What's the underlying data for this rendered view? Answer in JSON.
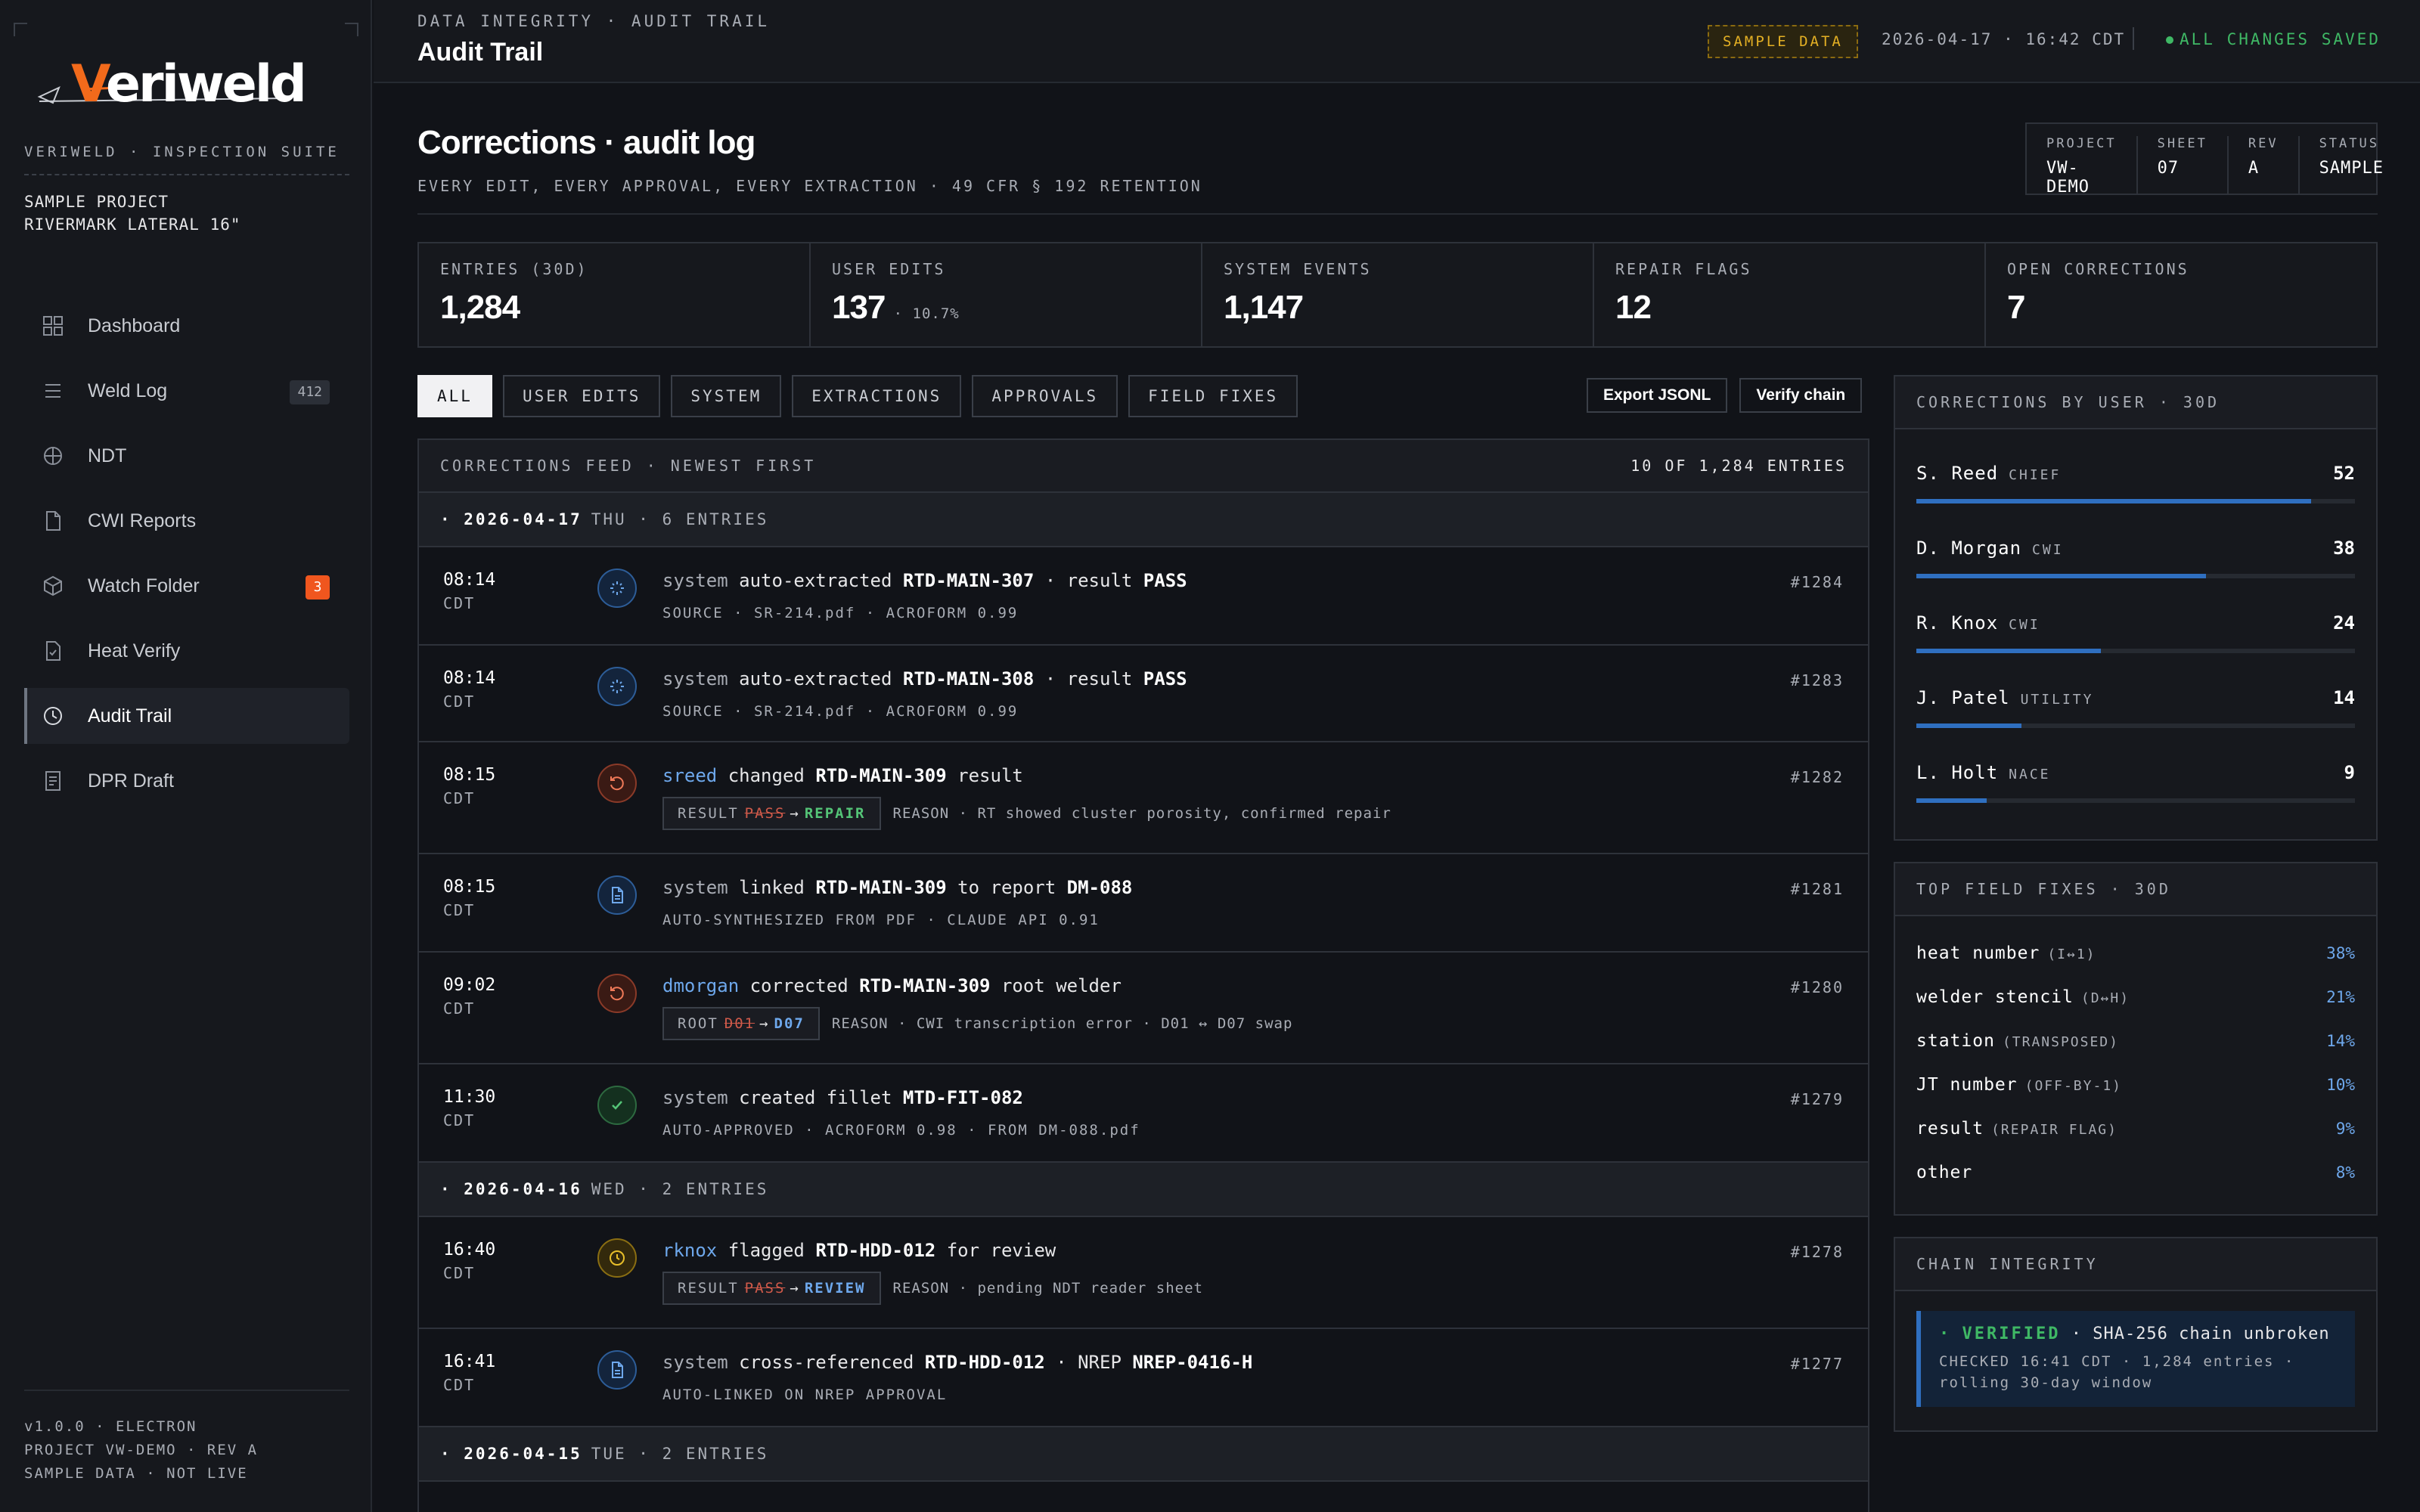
{
  "app": {
    "brand": "Veriweld",
    "brand_first": "V",
    "brand_rest": "eriweld",
    "suite": "VERIWELD · INSPECTION SUITE",
    "project_line1": "SAMPLE PROJECT",
    "project_line2": "RIVERMARK LATERAL 16\"",
    "footer_line1": "v1.0.0 · ELECTRON",
    "footer_line2": "PROJECT VW-DEMO · REV A",
    "footer_line3": "SAMPLE DATA · NOT LIVE"
  },
  "nav": [
    {
      "label": "Dashboard",
      "icon": "grid-icon",
      "badge": ""
    },
    {
      "label": "Weld Log",
      "icon": "list-icon",
      "badge": "412"
    },
    {
      "label": "NDT",
      "icon": "crosshair-icon",
      "badge": ""
    },
    {
      "label": "CWI Reports",
      "icon": "document-icon",
      "badge": ""
    },
    {
      "label": "Watch Folder",
      "icon": "cube-icon",
      "badge": "3"
    },
    {
      "label": "Heat Verify",
      "icon": "file-check-icon",
      "badge": ""
    },
    {
      "label": "Audit Trail",
      "icon": "clock-icon",
      "badge": "",
      "active": true
    },
    {
      "label": "DPR Draft",
      "icon": "report-icon",
      "badge": ""
    }
  ],
  "topbar": {
    "breadcrumb": "DATA INTEGRITY · AUDIT TRAIL",
    "title": "Audit Trail",
    "sample_badge": "SAMPLE DATA",
    "datetime": "2026-04-17 · 16:42 CDT",
    "save_status": "ALL CHANGES SAVED"
  },
  "header": {
    "title": "Corrections · audit log",
    "subtitle": "EVERY EDIT, EVERY APPROVAL, EVERY EXTRACTION · 49 CFR § 192 RETENTION",
    "meta": [
      {
        "label": "PROJECT",
        "value": "VW-DEMO"
      },
      {
        "label": "SHEET",
        "value": "07"
      },
      {
        "label": "REV",
        "value": "A"
      },
      {
        "label": "STATUS",
        "value": "SAMPLE"
      }
    ]
  },
  "kpis": [
    {
      "label": "ENTRIES (30D)",
      "value": "1,284",
      "sub": ""
    },
    {
      "label": "USER EDITS",
      "value": "137",
      "sub": "· 10.7%"
    },
    {
      "label": "SYSTEM EVENTS",
      "value": "1,147",
      "sub": ""
    },
    {
      "label": "REPAIR FLAGS",
      "value": "12",
      "sub": ""
    },
    {
      "label": "OPEN CORRECTIONS",
      "value": "7",
      "sub": ""
    }
  ],
  "filters": [
    "ALL",
    "USER EDITS",
    "SYSTEM",
    "EXTRACTIONS",
    "APPROVALS",
    "FIELD FIXES"
  ],
  "actions": {
    "export": "Export JSONL",
    "verify": "Verify chain"
  },
  "feed": {
    "title": "CORRECTIONS FEED · NEWEST FIRST",
    "count": "10 OF 1,284 ENTRIES",
    "days": [
      {
        "date": "· 2026-04-17",
        "rest": "THU · 6 ENTRIES"
      },
      {
        "date": "· 2026-04-16",
        "rest": "WED · 2 ENTRIES"
      },
      {
        "date": "· 2026-04-15",
        "rest": "TUE · 2 ENTRIES"
      }
    ],
    "entries": [
      {
        "time": "08:14",
        "tz": "CDT",
        "actor": "system",
        "verb": "auto-extracted",
        "obj": "RTD-MAIN-307",
        "tail": "· result",
        "tail_obj": "PASS",
        "meta": "SOURCE · SR-214.pdf · ACROFORM 0.99",
        "id": "#1284"
      },
      {
        "time": "08:14",
        "tz": "CDT",
        "actor": "system",
        "verb": "auto-extracted",
        "obj": "RTD-MAIN-308",
        "tail": "· result",
        "tail_obj": "PASS",
        "meta": "SOURCE · SR-214.pdf · ACROFORM 0.99",
        "id": "#1283"
      },
      {
        "time": "08:15",
        "tz": "CDT",
        "actor": "sreed",
        "verb": "changed",
        "obj": "RTD-MAIN-309",
        "tail": "result",
        "tail_obj": "",
        "chip_field": "RESULT",
        "chip_old": "PASS",
        "chip_new": "REPAIR",
        "reason": "REASON · RT showed cluster porosity, confirmed repair",
        "id": "#1282"
      },
      {
        "time": "08:15",
        "tz": "CDT",
        "actor": "system",
        "verb": "linked",
        "obj": "RTD-MAIN-309",
        "tail": "to report",
        "tail_obj": "DM-088",
        "meta": "AUTO-SYNTHESIZED FROM PDF · CLAUDE API 0.91",
        "id": "#1281"
      },
      {
        "time": "09:02",
        "tz": "CDT",
        "actor": "dmorgan",
        "verb": "corrected",
        "obj": "RTD-MAIN-309",
        "tail": "root welder",
        "tail_obj": "",
        "chip_field": "ROOT",
        "chip_old": "D01",
        "chip_new": "D07",
        "reason": "REASON · CWI transcription error · D01 ↔ D07 swap",
        "id": "#1280"
      },
      {
        "time": "11:30",
        "tz": "CDT",
        "actor": "system",
        "verb": "created fillet",
        "obj": "MTD-FIT-082",
        "tail": "",
        "tail_obj": "",
        "meta": "AUTO-APPROVED · ACROFORM 0.98 · FROM DM-088.pdf",
        "id": "#1279"
      },
      {
        "time": "16:40",
        "tz": "CDT",
        "actor": "rknox",
        "verb": "flagged",
        "obj": "RTD-HDD-012",
        "tail": "for review",
        "tail_obj": "",
        "chip_field": "RESULT",
        "chip_old": "PASS",
        "chip_new": "REVIEW",
        "reason": "REASON · pending NDT reader sheet",
        "id": "#1278"
      },
      {
        "time": "16:41",
        "tz": "CDT",
        "actor": "system",
        "verb": "cross-referenced",
        "obj": "RTD-HDD-012",
        "tail": "· NREP",
        "tail_obj": "NREP-0416-H",
        "meta": "AUTO-LINKED ON NREP APPROVAL",
        "id": "#1277"
      }
    ]
  },
  "corrections_by_user": {
    "title": "CORRECTIONS BY USER · 30D",
    "users": [
      {
        "name": "S. Reed",
        "role": "CHIEF",
        "count": "52",
        "share": 0.9
      },
      {
        "name": "D. Morgan",
        "role": "CWI",
        "count": "38",
        "share": 0.66
      },
      {
        "name": "R. Knox",
        "role": "CWI",
        "count": "24",
        "share": 0.42
      },
      {
        "name": "J. Patel",
        "role": "UTILITY",
        "count": "14",
        "share": 0.24
      },
      {
        "name": "L. Holt",
        "role": "NACE",
        "count": "9",
        "share": 0.16
      }
    ]
  },
  "field_fixes": {
    "title": "TOP FIELD FIXES · 30D",
    "rows": [
      {
        "name": "heat number",
        "hint": "(I↔1)",
        "pct": "38%"
      },
      {
        "name": "welder stencil",
        "hint": "(D↔H)",
        "pct": "21%"
      },
      {
        "name": "station",
        "hint": "(TRANSPOSED)",
        "pct": "14%"
      },
      {
        "name": "JT number",
        "hint": "(OFF-BY-1)",
        "pct": "10%"
      },
      {
        "name": "result",
        "hint": "(REPAIR FLAG)",
        "pct": "9%"
      },
      {
        "name": "other",
        "hint": "",
        "pct": "8%"
      }
    ]
  },
  "chain": {
    "title": "CHAIN INTEGRITY",
    "status": "VERIFIED",
    "status_prefix": "·",
    "message": "· SHA-256 chain unbroken",
    "detail1": "CHECKED 16:41 CDT · 1,284 entries ·",
    "detail2": "rolling 30-day window"
  },
  "colors": {
    "accent": "#2f6fc0",
    "brand": "#f26a1b",
    "ok": "#3fb865",
    "warn": "#e4b024"
  }
}
